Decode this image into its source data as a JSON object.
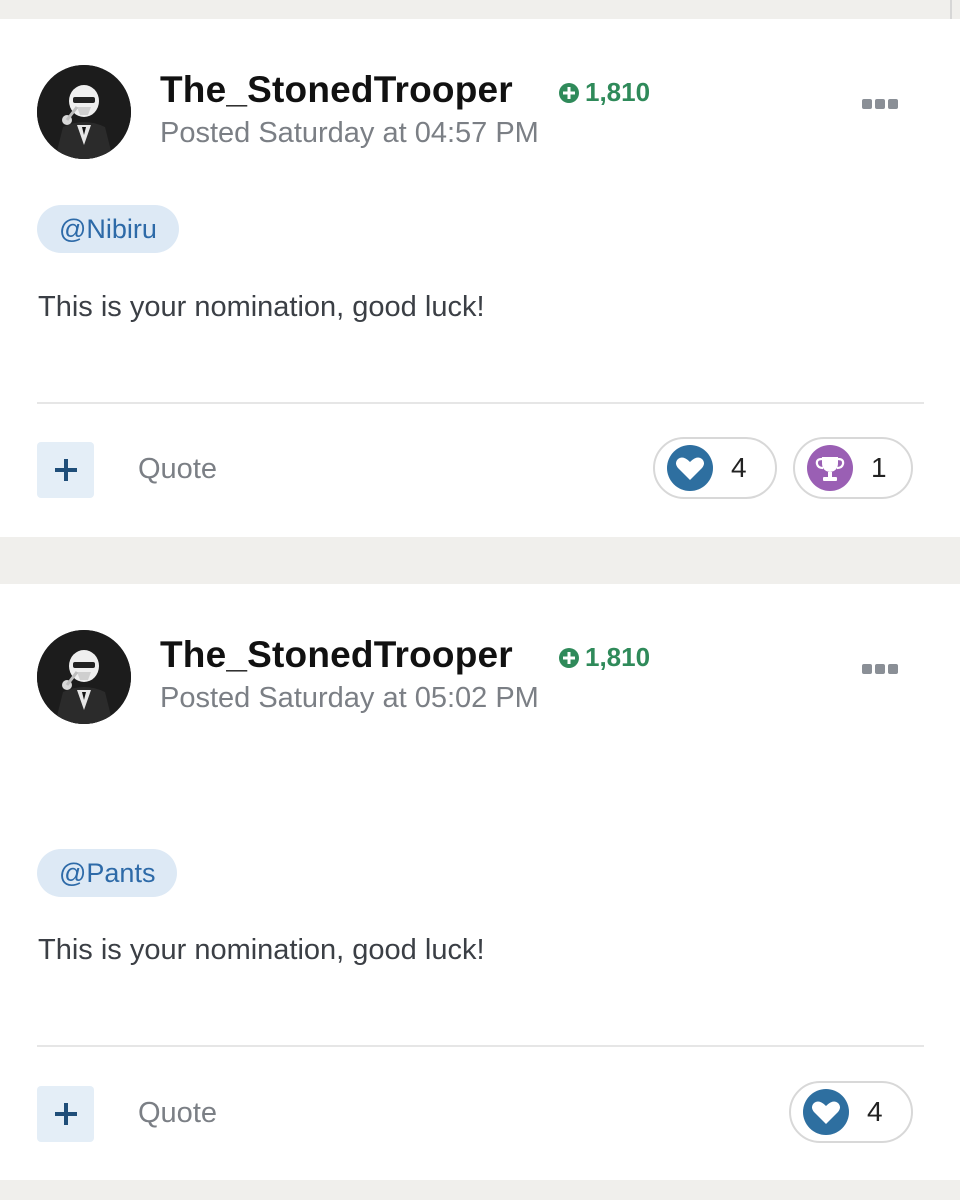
{
  "posts": [
    {
      "author": "The_StonedTrooper",
      "reputation": "1,810",
      "meta": "Posted Saturday at 04:57 PM",
      "mention": "@Nibiru",
      "content": "This is your nomination, good luck!",
      "quote_label": "Quote",
      "reactions": [
        {
          "icon": "heart-icon",
          "count": "4",
          "color": "#2e6fa0"
        },
        {
          "icon": "trophy-icon",
          "count": "1",
          "color": "#9a5fb4"
        }
      ]
    },
    {
      "author": "The_StonedTrooper",
      "reputation": "1,810",
      "meta": "Posted Saturday at 05:02 PM",
      "mention": "@Pants",
      "content": "This is your nomination, good luck!",
      "quote_label": "Quote",
      "reactions": [
        {
          "icon": "heart-icon",
          "count": "4",
          "color": "#2e6fa0"
        }
      ]
    }
  ],
  "colors": {
    "reputation_green": "#2f8a5a",
    "mention_bg": "#dde9f5",
    "mention_text": "#2d6aa8",
    "page_bg": "#f0efec"
  }
}
